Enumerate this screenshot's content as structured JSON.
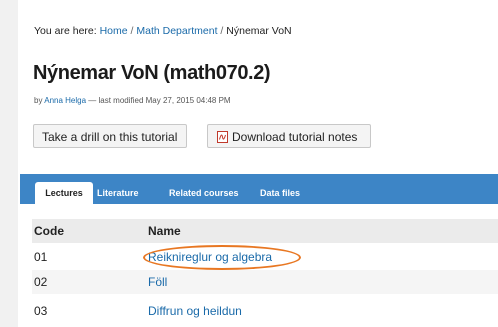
{
  "breadcrumb": {
    "prefix": "You are here:",
    "home": "Home",
    "separator": "/",
    "department": "Math Department",
    "current": "Nýnemar VoN"
  },
  "title": "Nýnemar VoN (math070.2)",
  "byline": {
    "by": "by",
    "author": "Anna Helga",
    "modified": "— last modified May 27, 2015 04:48 PM"
  },
  "buttons": {
    "drill": "Take a drill on this tutorial",
    "download": "Download tutorial notes",
    "download_icon": "pdf-icon"
  },
  "tabs": [
    {
      "label": "Lectures",
      "active": true
    },
    {
      "label": "Literature",
      "active": false
    },
    {
      "label": "Related courses",
      "active": false
    },
    {
      "label": "Data files",
      "active": false
    }
  ],
  "table": {
    "headers": [
      "Code",
      "Name"
    ],
    "rows": [
      {
        "code": "01",
        "name": "Reiknireglur og algebra"
      },
      {
        "code": "02",
        "name": "Föll"
      },
      {
        "code": "03",
        "name": "Diffrun og heildun"
      }
    ]
  },
  "colors": {
    "link": "#1a6aa9",
    "tabbar": "#3d85c6",
    "highlight": "#e87722"
  }
}
